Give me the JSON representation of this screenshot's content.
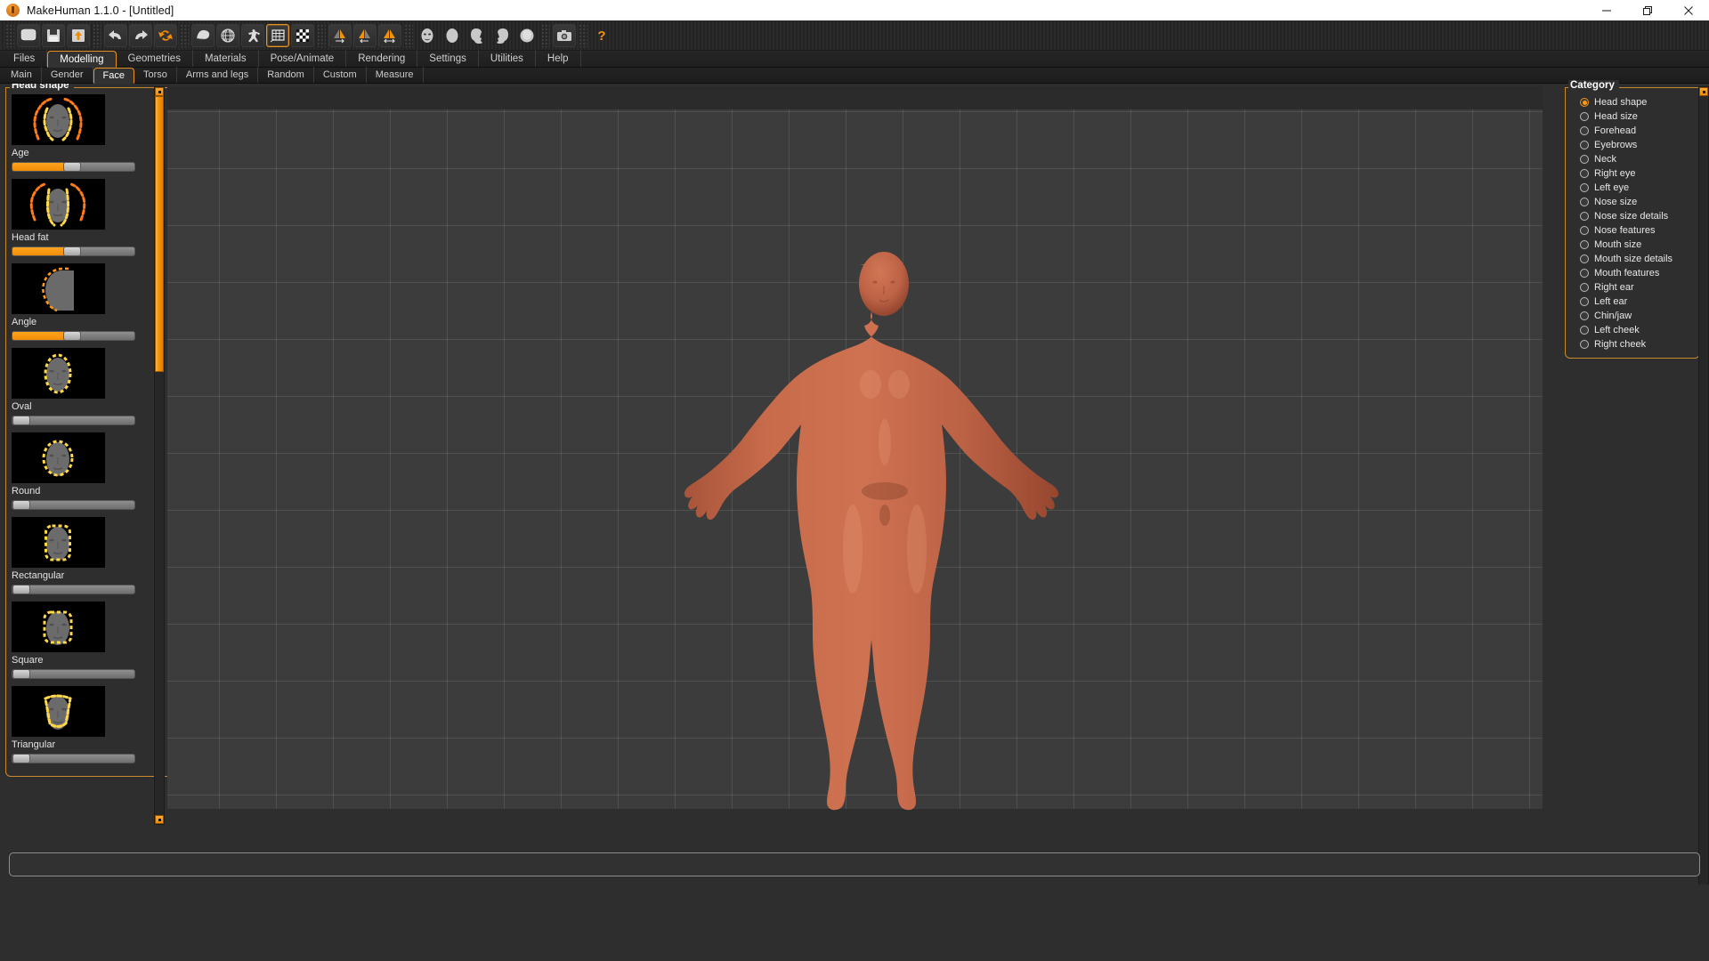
{
  "window": {
    "title": "MakeHuman 1.1.0 - [Untitled]",
    "app_icon": "makehuman-logo-icon",
    "controls": {
      "minimize": "minimize-icon",
      "maximize": "maximize-icon",
      "close": "close-icon"
    }
  },
  "toolbar": {
    "groups": [
      {
        "name": "file",
        "buttons": [
          {
            "name": "new-button",
            "icon": "new-document-icon",
            "active": false
          },
          {
            "name": "save-button",
            "icon": "floppy-save-icon",
            "active": false
          },
          {
            "name": "load-button",
            "icon": "load-up-arrow-icon",
            "active": false
          }
        ]
      },
      {
        "name": "edit",
        "buttons": [
          {
            "name": "undo-button",
            "icon": "undo-arrow-icon",
            "active": false
          },
          {
            "name": "redo-button",
            "icon": "redo-arrow-icon",
            "active": false
          },
          {
            "name": "reset-button",
            "icon": "reset-circular-arrows-icon",
            "active": false
          }
        ]
      },
      {
        "name": "mesh-display",
        "buttons": [
          {
            "name": "smooth-button",
            "icon": "smooth-shading-icon",
            "active": false
          },
          {
            "name": "wireframe-button",
            "icon": "wireframe-globe-icon",
            "active": false
          },
          {
            "name": "pose-button",
            "icon": "pose-figure-icon",
            "active": false
          },
          {
            "name": "grid-button",
            "icon": "grid-icon",
            "active": true
          },
          {
            "name": "background-button",
            "icon": "checkerboard-icon",
            "active": false
          }
        ]
      },
      {
        "name": "symmetry",
        "buttons": [
          {
            "name": "symmetry-right-button",
            "icon": "symmetry-right-icon",
            "active": false
          },
          {
            "name": "symmetry-left-button",
            "icon": "symmetry-left-icon",
            "active": false
          },
          {
            "name": "symmetry-both-button",
            "icon": "symmetry-both-icon",
            "active": false
          }
        ]
      },
      {
        "name": "camera-views",
        "buttons": [
          {
            "name": "front-view-button",
            "icon": "face-front-icon",
            "active": false
          },
          {
            "name": "back-view-button",
            "icon": "head-back-icon",
            "active": false
          },
          {
            "name": "left-view-button",
            "icon": "head-left-profile-icon",
            "active": false
          },
          {
            "name": "right-view-button",
            "icon": "head-right-profile-icon",
            "active": false
          },
          {
            "name": "top-view-button",
            "icon": "head-top-icon",
            "active": false
          }
        ]
      },
      {
        "name": "capture",
        "buttons": [
          {
            "name": "grab-screen-button",
            "icon": "camera-icon",
            "active": false
          }
        ]
      },
      {
        "name": "help",
        "buttons": [
          {
            "name": "help-button",
            "icon": "question-mark-icon",
            "active": false
          }
        ]
      }
    ]
  },
  "main_tabs": {
    "active": "Modelling",
    "items": [
      {
        "label": "Files"
      },
      {
        "label": "Modelling"
      },
      {
        "label": "Geometries"
      },
      {
        "label": "Materials"
      },
      {
        "label": "Pose/Animate"
      },
      {
        "label": "Rendering"
      },
      {
        "label": "Settings"
      },
      {
        "label": "Utilities"
      },
      {
        "label": "Help"
      }
    ]
  },
  "sub_tabs": {
    "active": "Face",
    "items": [
      {
        "label": "Main"
      },
      {
        "label": "Gender"
      },
      {
        "label": "Face"
      },
      {
        "label": "Torso"
      },
      {
        "label": "Arms and legs"
      },
      {
        "label": "Random"
      },
      {
        "label": "Custom"
      },
      {
        "label": "Measure"
      }
    ]
  },
  "left_panel": {
    "group_title": "Head shape",
    "sliders": [
      {
        "label": "Age",
        "value": 0.49,
        "thumb_icon": "head-age-thumb"
      },
      {
        "label": "Head fat",
        "value": 0.49,
        "thumb_icon": "head-fat-thumb"
      },
      {
        "label": "Angle",
        "value": 0.49,
        "thumb_icon": "head-angle-thumb"
      },
      {
        "label": "Oval",
        "value": 0.0,
        "thumb_icon": "head-oval-thumb"
      },
      {
        "label": "Round",
        "value": 0.0,
        "thumb_icon": "head-round-thumb"
      },
      {
        "label": "Rectangular",
        "value": 0.0,
        "thumb_icon": "head-rectangular-thumb"
      },
      {
        "label": "Square",
        "value": 0.0,
        "thumb_icon": "head-square-thumb"
      },
      {
        "label": "Triangular",
        "value": 0.0,
        "thumb_icon": "head-triangular-thumb"
      }
    ]
  },
  "right_panel": {
    "group_title": "Category",
    "selected": "Head shape",
    "items": [
      {
        "label": "Head shape",
        "selected": true
      },
      {
        "label": "Head size",
        "selected": false
      },
      {
        "label": "Forehead",
        "selected": false
      },
      {
        "label": "Eyebrows",
        "selected": false
      },
      {
        "label": "Neck",
        "selected": false
      },
      {
        "label": "Right eye",
        "selected": false
      },
      {
        "label": "Left eye",
        "selected": false
      },
      {
        "label": "Nose size",
        "selected": false
      },
      {
        "label": "Nose size details",
        "selected": false
      },
      {
        "label": "Nose features",
        "selected": false
      },
      {
        "label": "Mouth size",
        "selected": false
      },
      {
        "label": "Mouth size details",
        "selected": false
      },
      {
        "label": "Mouth features",
        "selected": false
      },
      {
        "label": "Right ear",
        "selected": false
      },
      {
        "label": "Left ear",
        "selected": false
      },
      {
        "label": "Chin/jaw",
        "selected": false
      },
      {
        "label": "Left cheek",
        "selected": false
      },
      {
        "label": "Right cheek",
        "selected": false
      }
    ]
  },
  "viewport": {
    "name": "3d-model-viewport",
    "model": "human-female-figure",
    "grid_visible": true
  },
  "status_bar": {
    "text": ""
  },
  "colors": {
    "accent": "#f09010",
    "panel_bg": "#2e2e2e",
    "viewport_bg": "#3c3c3c",
    "skin": "#c1674a",
    "group_border": "#c98a2a"
  }
}
